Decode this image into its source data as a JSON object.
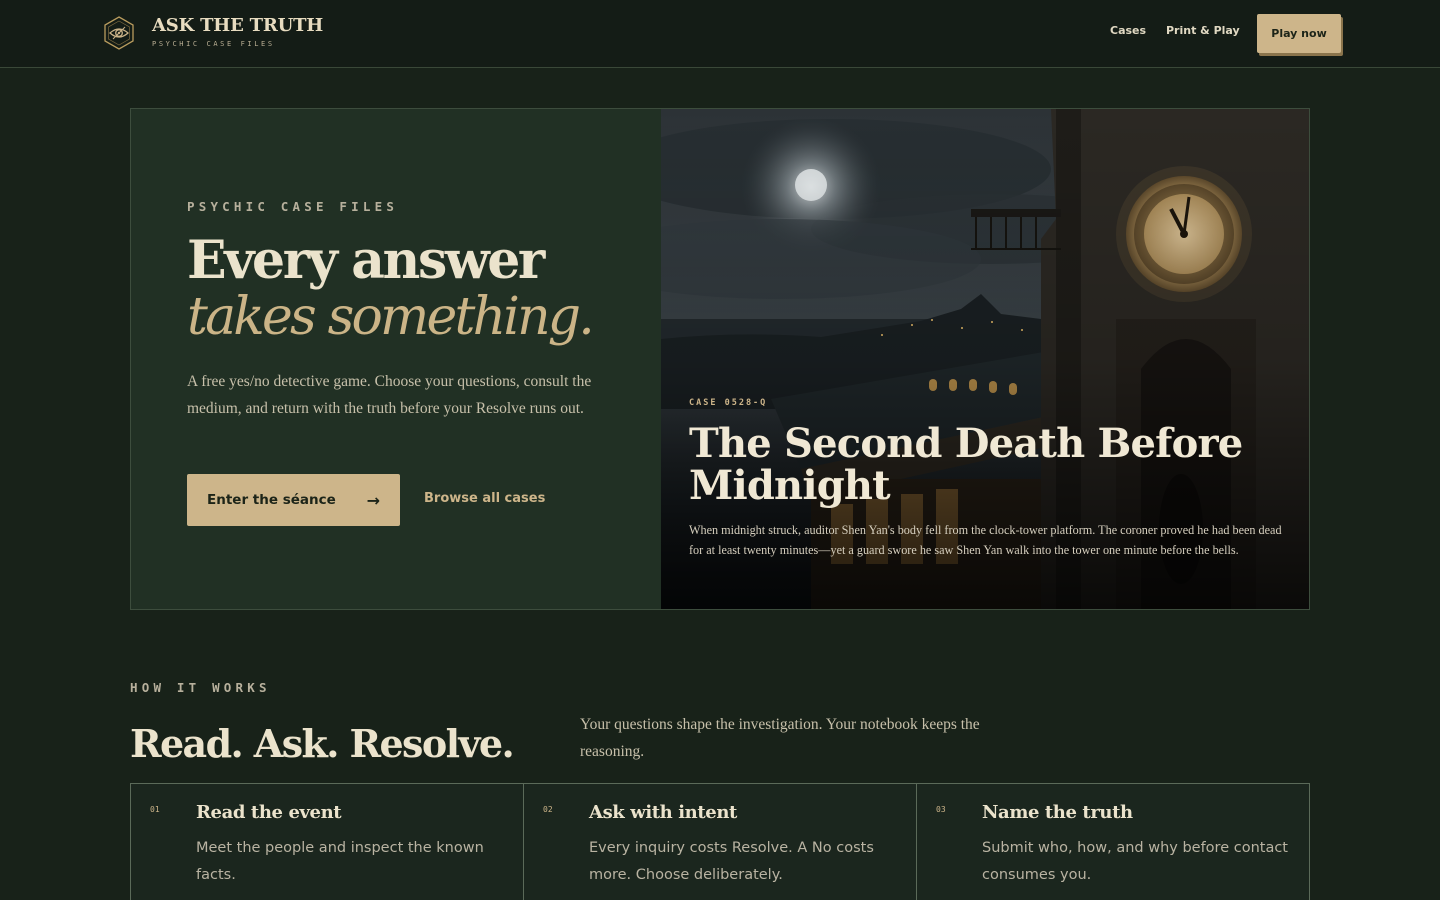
{
  "header": {
    "brand_title": "ASK THE TRUTH",
    "brand_subtitle": "PSYCHIC CASE FILES",
    "logo_icon": "eye-icon",
    "nav": [
      {
        "label": "Cases"
      },
      {
        "label": "Print & Play"
      }
    ],
    "play_label": "Play now"
  },
  "hero": {
    "eyebrow": "PSYCHIC CASE FILES",
    "headline_line1": "Every answer",
    "headline_line2": "takes something.",
    "description": "A free yes/no detective game. Choose your questions, consult the medium, and return with the truth before your Resolve runs out.",
    "cta_label": "Enter the séance",
    "cta_icon": "→",
    "secondary_label": "Browse all cases"
  },
  "featured_case": {
    "case_id": "CASE 0528-Q",
    "title": "The Second Death Before Midnight",
    "description": "When midnight struck, auditor Shen Yan's body fell from the clock-tower platform. The coroner proved he had been dead for at least twenty minutes—yet a guard swore he saw Shen Yan walk into the tower one minute before the bells."
  },
  "how_it_works": {
    "eyebrow": "HOW IT WORKS",
    "title": "Read. Ask. Resolve.",
    "description": "Your questions shape the investigation. Your notebook keeps the reasoning.",
    "steps": [
      {
        "num": "01",
        "title": "Read the event",
        "desc": "Meet the people and inspect the known facts."
      },
      {
        "num": "02",
        "title": "Ask with intent",
        "desc": "Every inquiry costs Resolve. A No costs more. Choose deliberately."
      },
      {
        "num": "03",
        "title": "Name the truth",
        "desc": "Submit who, how, and why before contact consumes you."
      }
    ]
  },
  "colors": {
    "background": "#182219",
    "panel": "#213024",
    "accent_gold": "#cdb58a",
    "text_cream": "#ebe3cc"
  }
}
